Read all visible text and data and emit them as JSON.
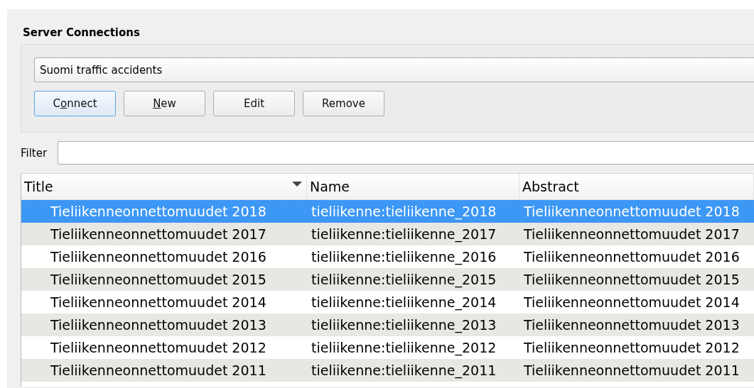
{
  "server_connections": {
    "title": "Server Connections",
    "connection": "Suomi traffic accidents",
    "buttons": [
      {
        "pre": "C",
        "key": "o",
        "post": "nnect",
        "focused": true
      },
      {
        "key": "N",
        "post": "ew",
        "focused": false
      },
      {
        "pre": "Edit",
        "focused": false
      },
      {
        "pre": "Remove",
        "focused": false
      }
    ]
  },
  "filter": {
    "label": "Filter"
  },
  "table": {
    "columns": [
      "Title",
      "Name",
      "Abstract"
    ],
    "rows": [
      {
        "cells": [
          "Tieliikenneonnettomuudet 2018",
          "tieliikenne:tieliikenne_2018",
          "Tieliikenneonnettomuudet 2018"
        ],
        "selected": true
      },
      {
        "cells": [
          "Tieliikenneonnettomuudet 2017",
          "tieliikenne:tieliikenne_2017",
          "Tieliikenneonnettomuudet 2017"
        ],
        "selected": false
      },
      {
        "cells": [
          "Tieliikenneonnettomuudet 2016",
          "tieliikenne:tieliikenne_2016",
          "Tieliikenneonnettomuudet 2016"
        ],
        "selected": false
      },
      {
        "cells": [
          "Tieliikenneonnettomuudet 2015",
          "tieliikenne:tieliikenne_2015",
          "Tieliikenneonnettomuudet 2015"
        ],
        "selected": false
      },
      {
        "cells": [
          "Tieliikenneonnettomuudet 2014",
          "tieliikenne:tieliikenne_2014",
          "Tieliikenneonnettomuudet 2014"
        ],
        "selected": false
      },
      {
        "cells": [
          "Tieliikenneonnettomuudet 2013",
          "tieliikenne:tieliikenne_2013",
          "Tieliikenneonnettomuudet 2013"
        ],
        "selected": false
      },
      {
        "cells": [
          "Tieliikenneonnettomuudet 2012",
          "tieliikenne:tieliikenne_2012",
          "Tieliikenneonnettomuudet 2012"
        ],
        "selected": false
      },
      {
        "cells": [
          "Tieliikenneonnettomuudet 2011",
          "tieliikenne:tieliikenne_2011",
          "Tieliikenneonnettomuudet 2011"
        ],
        "selected": false
      }
    ]
  }
}
